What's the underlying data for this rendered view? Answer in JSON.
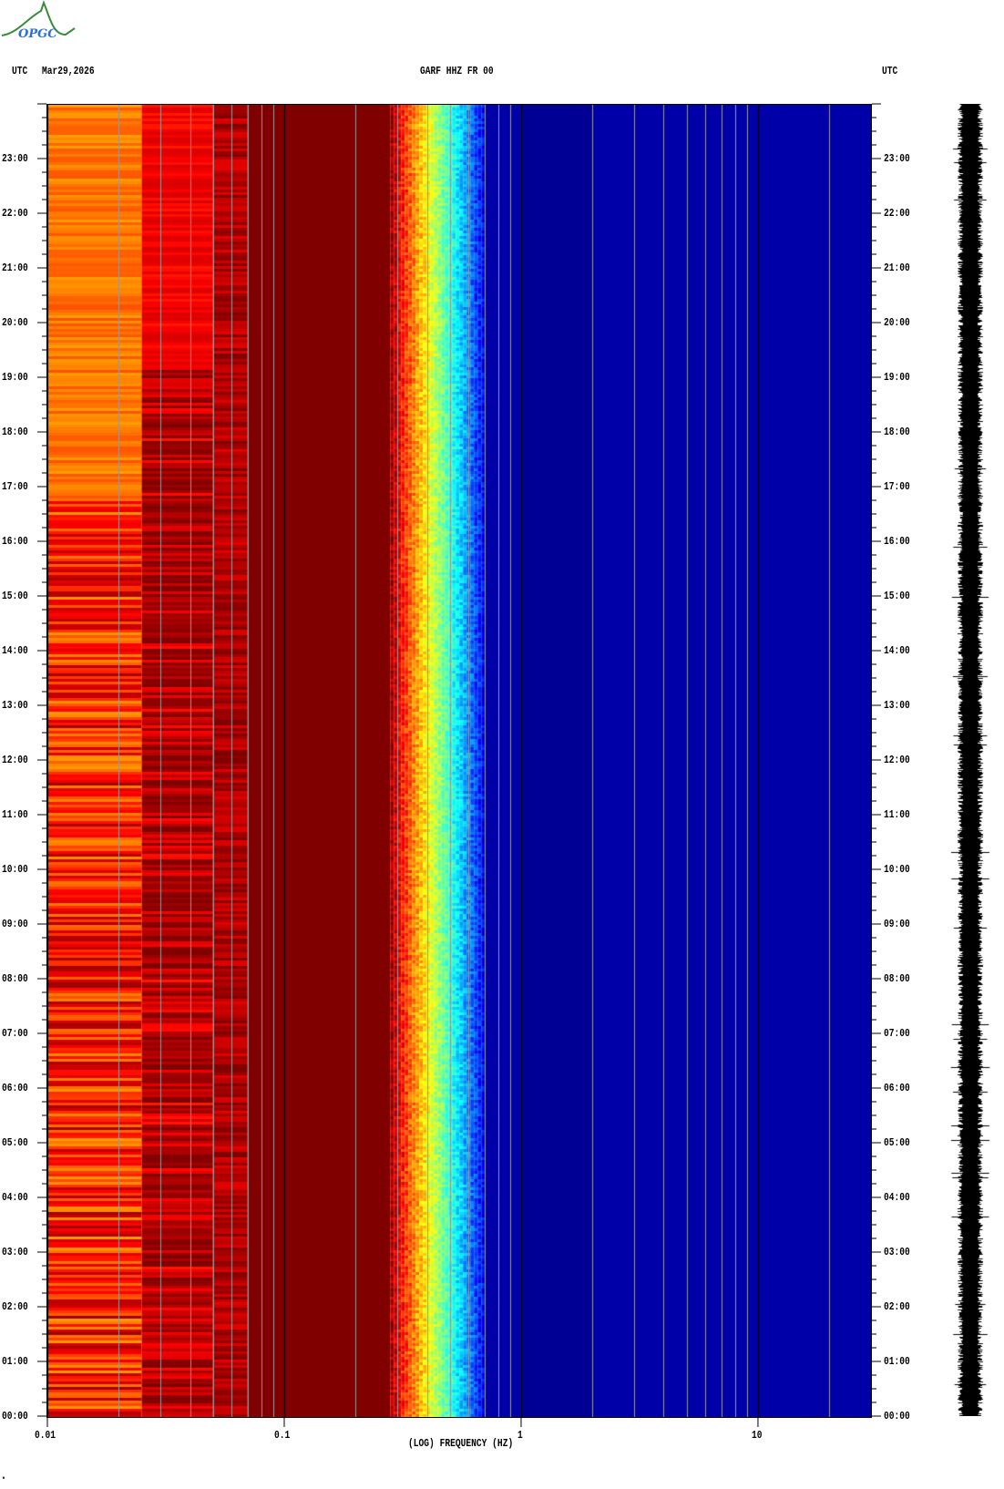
{
  "logo": {
    "text": "OPGC",
    "colors": {
      "curve": "#3a8c3a",
      "text": "#2a6fd6"
    }
  },
  "header": {
    "left_tz": "UTC",
    "date": "Mar29,2026",
    "station": "GARF HHZ FR 00",
    "right_tz": "UTC"
  },
  "chart_data": {
    "type": "heatmap",
    "title": "GARF HHZ FR 00",
    "date": "Mar29,2026",
    "xlabel": "(LOG) FREQUENCY (HZ)",
    "xscale": "log",
    "xlim": [
      0.01,
      30
    ],
    "x_ticks": [
      {
        "value": 0.01,
        "label": "0.01"
      },
      {
        "value": 0.1,
        "label": "0.1"
      },
      {
        "value": 1,
        "label": "1"
      },
      {
        "value": 10,
        "label": "10"
      }
    ],
    "ylabel": "UTC",
    "ylim_hours": [
      0,
      24
    ],
    "y_ticks": [
      "00:00",
      "01:00",
      "02:00",
      "03:00",
      "04:00",
      "05:00",
      "06:00",
      "07:00",
      "08:00",
      "09:00",
      "10:00",
      "11:00",
      "12:00",
      "13:00",
      "14:00",
      "15:00",
      "16:00",
      "17:00",
      "18:00",
      "19:00",
      "20:00",
      "21:00",
      "22:00",
      "23:00"
    ],
    "bands": [
      {
        "range_hz": [
          0.01,
          0.025
        ],
        "level": "high, yellow/orange/red varying"
      },
      {
        "range_hz": [
          0.025,
          0.07
        ],
        "level": "red/dark red varying"
      },
      {
        "range_hz": [
          0.07,
          0.28
        ],
        "level": "saturated dark red"
      },
      {
        "range_hz": [
          0.28,
          0.6
        ],
        "level": "transition red-yellow-cyan-blue"
      },
      {
        "range_hz": [
          0.6,
          30
        ],
        "level": "low, blue"
      }
    ],
    "colors": {
      "max": "#800000",
      "min": "#000090"
    }
  },
  "footer_mark": "*"
}
